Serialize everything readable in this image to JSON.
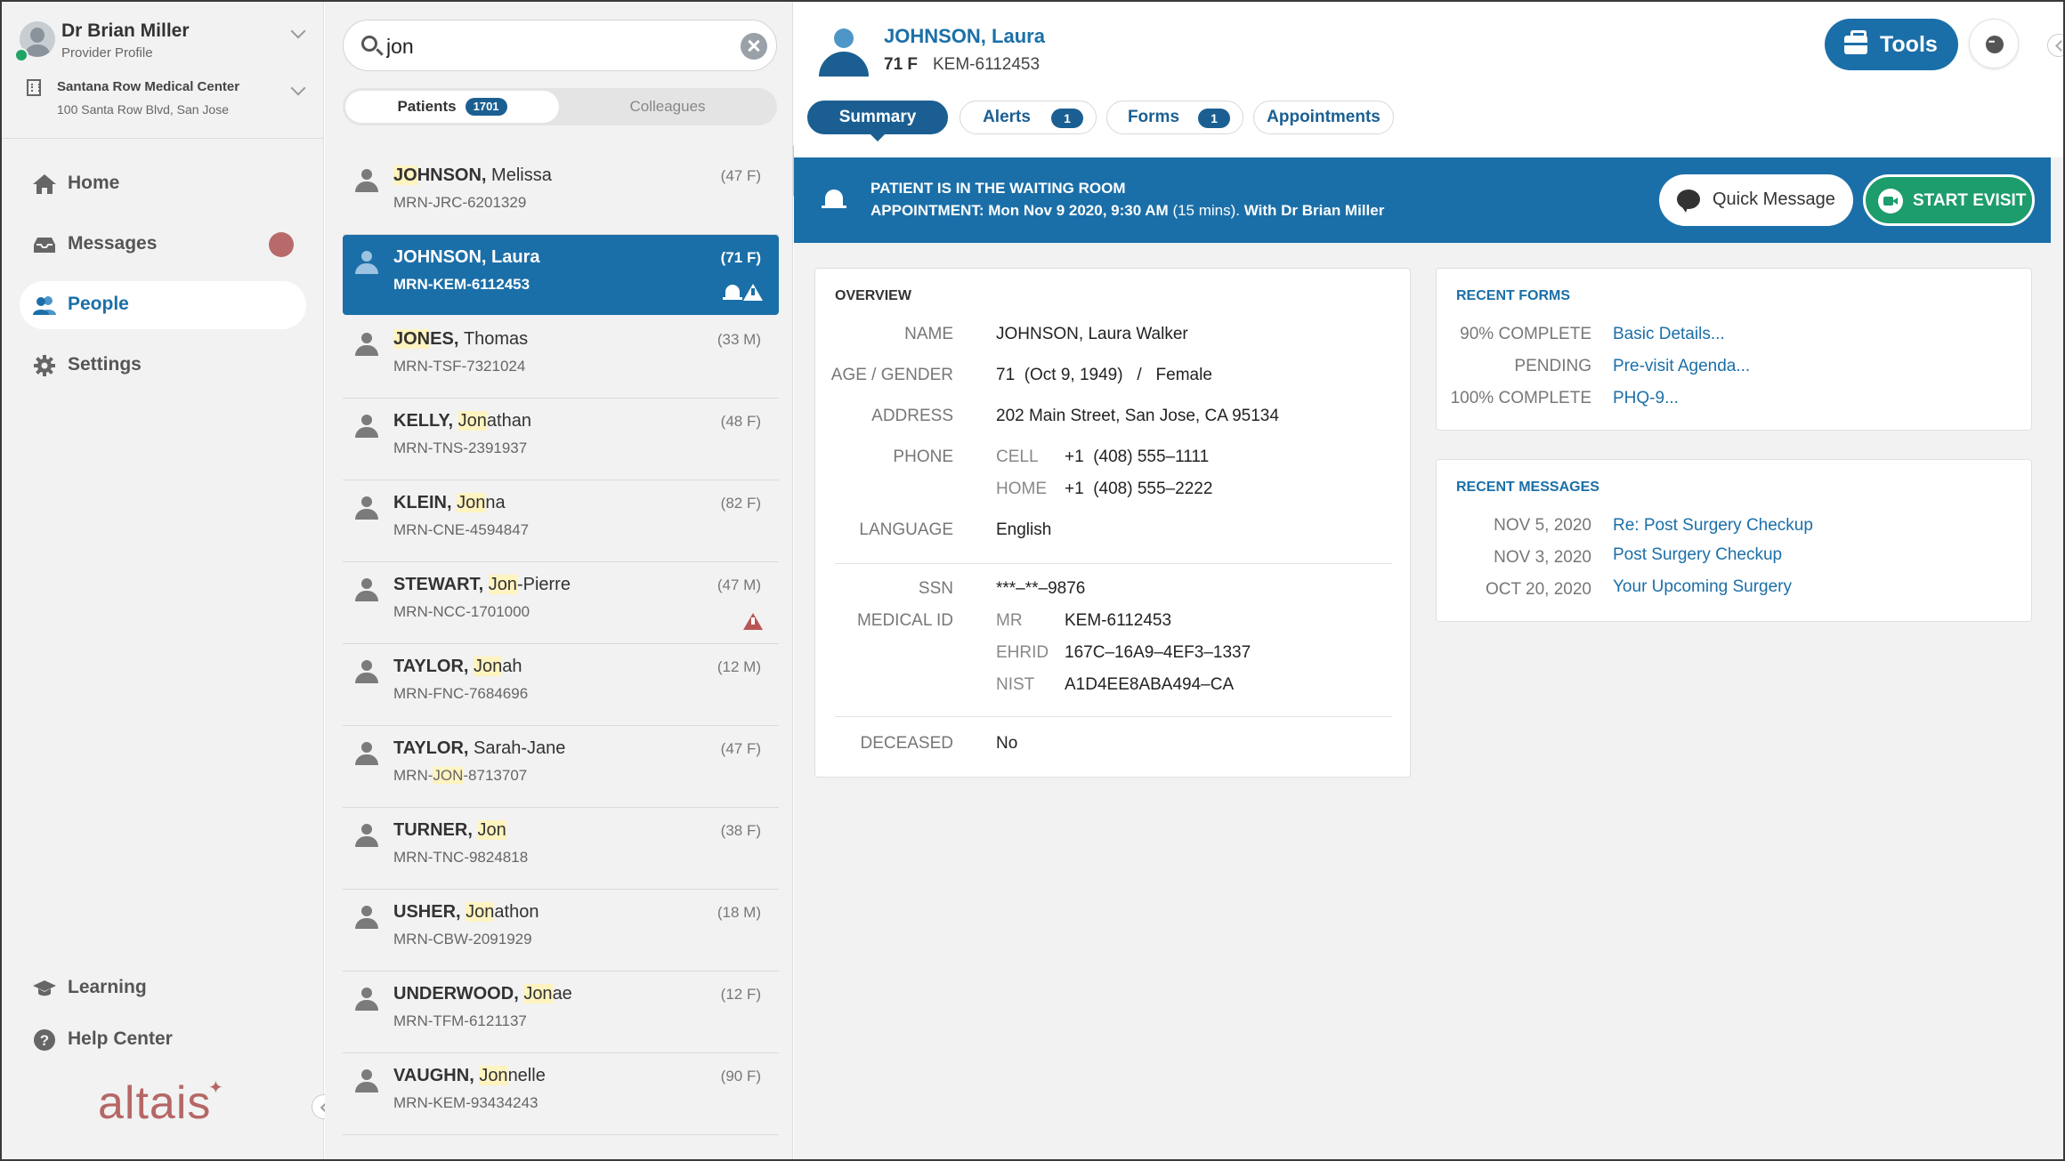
{
  "profile": {
    "name": "Dr Brian Miller",
    "role": "Provider Profile",
    "clinic_name": "Santana Row Medical Center",
    "clinic_address": "100 Santa Row Blvd, San Jose"
  },
  "nav": {
    "home": "Home",
    "messages": "Messages",
    "people": "People",
    "settings": "Settings",
    "learning": "Learning",
    "help": "Help Center",
    "active": "People"
  },
  "logo": {
    "text": "altais",
    "star": "✦"
  },
  "search": {
    "value": "jon",
    "placeholder": "Search",
    "tab_patients": "Patients",
    "patients_count": "1701",
    "tab_colleagues": "Colleagues"
  },
  "patients": [
    {
      "last": "JOHNSON",
      "hl_last": "JO",
      "rest_last": "HNSON",
      "first": "Melissa",
      "mrn": "MRN-JRC-6201329",
      "age": "(47 F)"
    },
    {
      "last": "JOHNSON",
      "hl_last": "JO",
      "rest_last": "HNSON",
      "first": "Laura",
      "mrn": "MRN-KEM-6112453",
      "age": "(71 F)",
      "selected": true
    },
    {
      "last": "JONES",
      "hl_last": "JON",
      "rest_last": "ES",
      "first": "Thomas",
      "mrn": "MRN-TSF-7321024",
      "age": "(33 M)"
    },
    {
      "last": "KELLY",
      "first_hl": "Jon",
      "first_rest": "athan",
      "mrn": "MRN-TNS-2391937",
      "age": "(48 F)"
    },
    {
      "last": "KLEIN",
      "first_hl": "Jon",
      "first_rest": "na",
      "mrn": "MRN-CNE-4594847",
      "age": "(82 F)"
    },
    {
      "last": "STEWART",
      "first_hl": "Jon",
      "first_rest": "-Pierre",
      "mrn": "MRN-NCC-1701000",
      "age": "(47 M)",
      "warning": true
    },
    {
      "last": "TAYLOR",
      "first_hl": "Jon",
      "first_rest": "ah",
      "mrn": "MRN-FNC-7684696",
      "age": "(12 M)"
    },
    {
      "last": "TAYLOR",
      "first": "Sarah-Jane",
      "mrn_pre": "MRN-",
      "mrn_hl": "JON",
      "mrn_post": "-8713707",
      "age": "(47 F)"
    },
    {
      "last": "TURNER",
      "first_hl": "Jon",
      "first_rest": "",
      "mrn": "MRN-TNC-9824818",
      "age": "(38 F)"
    },
    {
      "last": "USHER",
      "first_hl": "Jon",
      "first_rest": "athon",
      "mrn": "MRN-CBW-2091929",
      "age": "(18 M)"
    },
    {
      "last": "UNDERWOOD",
      "first_hl": "Jon",
      "first_rest": "ae",
      "mrn": "MRN-TFM-6121137",
      "age": "(12 F)"
    },
    {
      "last": "VAUGHN",
      "first_hl": "Jon",
      "first_rest": "nelle",
      "mrn": "MRN-KEM-93434243",
      "age": "(90 F)"
    }
  ],
  "header": {
    "patient_name": "JOHNSON, Laura",
    "age_gender": "71 F",
    "mrn": "KEM-6112453",
    "tools_label": "Tools"
  },
  "tabs": [
    {
      "label": "Summary",
      "badge": ""
    },
    {
      "label": "Alerts",
      "badge": "1"
    },
    {
      "label": "Forms",
      "badge": "1"
    },
    {
      "label": "Appointments",
      "badge": ""
    }
  ],
  "banner": {
    "line1": "PATIENT IS IN THE WAITING ROOM",
    "line2_a": "APPOINTMENT: Mon Nov 9 2020, 9:30 AM",
    "line2_b": " (15 mins).",
    "line2_c": "  With Dr Brian Miller",
    "quick_message": "Quick Message",
    "start_evisit": "START EVISIT"
  },
  "overview": {
    "title": "OVERVIEW",
    "name_label": "NAME",
    "name": "JOHNSON, Laura Walker",
    "agegender_label": "AGE / GENDER",
    "age": "71  (Oct 9, 1949)   /   Female",
    "address_label": "ADDRESS",
    "address": "202 Main Street, San Jose, CA 95134",
    "phone_label": "PHONE",
    "cell_label": "CELL",
    "cell": "+1  (408) 555–1111",
    "home_label": "HOME",
    "home": "+1  (408) 555–2222",
    "language_label": "LANGUAGE",
    "language": "English",
    "ssn_label": "SSN",
    "ssn": "***–**–9876",
    "medid_label": "MEDICAL ID",
    "mr_label": "MR",
    "mr": "KEM-6112453",
    "ehrid_label": "EHRID",
    "ehrid": "167C–16A9–4EF3–1337",
    "nist_label": "NIST",
    "nist": "A1D4EE8ABA494–CA",
    "deceased_label": "DECEASED",
    "deceased": "No"
  },
  "recent_forms": {
    "title": "RECENT FORMS",
    "items": [
      {
        "status": "90% COMPLETE",
        "name": "Basic Details..."
      },
      {
        "status": "PENDING",
        "name": "Pre-visit Agenda..."
      },
      {
        "status": "100% COMPLETE",
        "name": "PHQ-9..."
      }
    ]
  },
  "recent_messages": {
    "title": "RECENT MESSAGES",
    "items": [
      {
        "date": "NOV 5, 2020",
        "subject": "Re: Post Surgery Checkup"
      },
      {
        "date": "NOV 3, 2020",
        "subject": "Post Surgery Checkup"
      },
      {
        "date": "OCT 20, 2020",
        "subject": "Your Upcoming Surgery"
      }
    ]
  },
  "colors": {
    "primary": "#1b6fa8",
    "dark": "#1b5f92",
    "green": "#1d9c6c",
    "alert": "#b85656",
    "logo": "#b56766"
  }
}
